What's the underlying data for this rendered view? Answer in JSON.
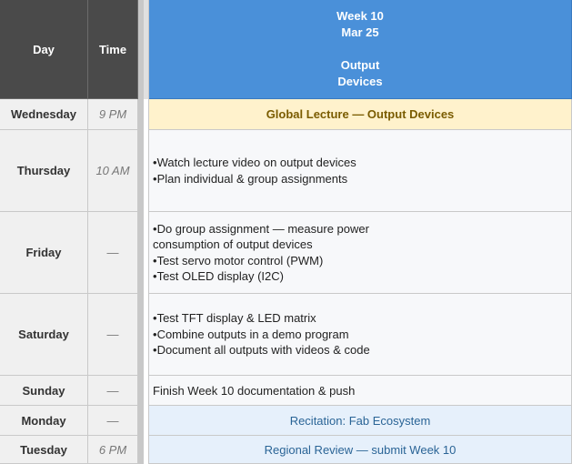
{
  "header": {
    "day_label": "Day",
    "time_label": "Time",
    "week_line1": "Week 10",
    "week_line2": "Mar 25",
    "week_line3": "Output",
    "week_line4": "Devices"
  },
  "rows": [
    {
      "day": "Wednesday",
      "time": "9 PM",
      "content": "Global Lecture — Output Devices"
    },
    {
      "day": "Thursday",
      "time": "10 AM",
      "items": [
        "Watch lecture video on output devices",
        "Plan individual & group assignments"
      ]
    },
    {
      "day": "Friday",
      "time": "—",
      "items": [
        "Do group assignment — measure power",
        "consumption of output devices",
        "Test servo motor control (PWM)",
        "Test OLED display (I2C)"
      ]
    },
    {
      "day": "Saturday",
      "time": "—",
      "items": [
        "Test TFT display & LED matrix",
        "Combine outputs in a demo program",
        "Document all outputs with videos & code"
      ]
    },
    {
      "day": "Sunday",
      "time": "—",
      "content": "Finish Week 10 documentation & push"
    },
    {
      "day": "Monday",
      "time": "—",
      "content": "Recitation: Fab Ecosystem"
    },
    {
      "day": "Tuesday",
      "time": "6 PM",
      "content": "Regional Review — submit Week 10"
    }
  ]
}
